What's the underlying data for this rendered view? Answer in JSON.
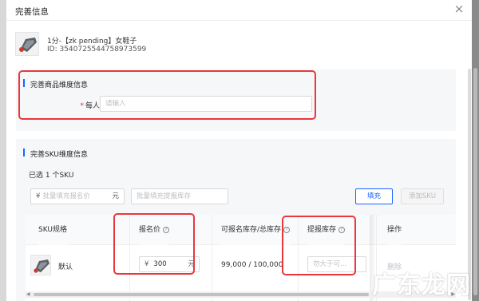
{
  "modal": {
    "title": "完善信息",
    "close_glyph": "×"
  },
  "product": {
    "name": "1分-【zk pending】女鞋子",
    "id": "ID: 3540725544758973599"
  },
  "section_product": {
    "title": "完善商品维度信息",
    "limit_label": "每人限购",
    "limit_placeholder": "请输入"
  },
  "section_sku": {
    "title": "完善SKU维度信息",
    "selected_count": "已选 1 个SKU",
    "bulk_price_yen": "¥",
    "bulk_price_placeholder": "批量填充报名价",
    "bulk_price_unit": "元",
    "bulk_stock_placeholder": "批量填充提报库存",
    "fill_button": "填充",
    "add_sku_button": "添加SKU"
  },
  "table": {
    "headers": {
      "sku_spec": "SKU规格",
      "price": "报名价",
      "stock_ratio": "可报名库存/总库存",
      "submit_stock": "提报库存",
      "action": "操作"
    },
    "rows": [
      {
        "spec": "默认",
        "price_yen": "¥",
        "price": "300",
        "price_unit": "元",
        "stock": "99,000 / 100,000",
        "submit_stock_placeholder": "勿大于可...",
        "action": "删除"
      }
    ]
  },
  "watermark": {
    "text": "广东龙网"
  },
  "colors": {
    "accent": "#1966ff",
    "highlight": "#e8383d",
    "required": "#f5222d"
  }
}
